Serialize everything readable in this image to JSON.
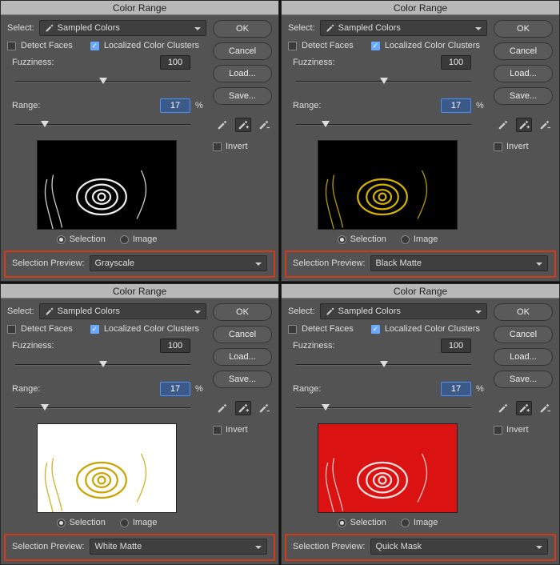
{
  "panels": [
    {
      "selectionPreview": "Grayscale",
      "previewMode": "grayscale"
    },
    {
      "selectionPreview": "Black Matte",
      "previewMode": "black"
    },
    {
      "selectionPreview": "White Matte",
      "previewMode": "white"
    },
    {
      "selectionPreview": "Quick Mask",
      "previewMode": "quickmask"
    }
  ],
  "common": {
    "title": "Color Range",
    "selectLabel": "Select:",
    "selectValue": "Sampled Colors",
    "detectFaces": "Detect Faces",
    "detectFacesChecked": false,
    "localizedClusters": "Localized Color Clusters",
    "localizedClustersChecked": true,
    "fuzzinessLabel": "Fuzziness:",
    "fuzzinessValue": "100",
    "fuzzinessPos": 50,
    "rangeLabel": "Range:",
    "rangeValue": "17",
    "rangePercent": "%",
    "rangePos": 17,
    "selectionRadio": "Selection",
    "imageRadio": "Image",
    "selectionPreviewLabel": "Selection Preview:",
    "invertLabel": "Invert",
    "invertChecked": false,
    "buttons": {
      "ok": "OK",
      "cancel": "Cancel",
      "load": "Load...",
      "save": "Save..."
    }
  }
}
